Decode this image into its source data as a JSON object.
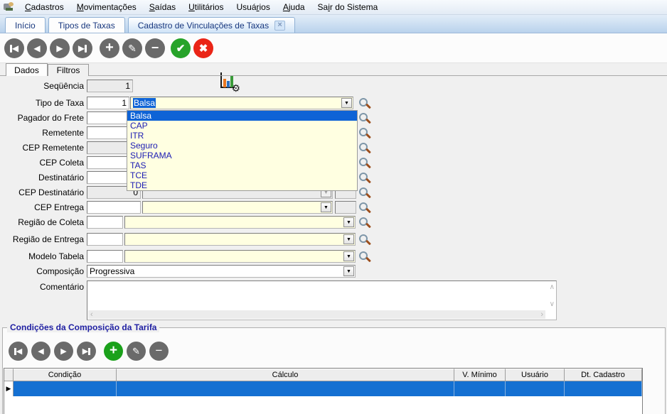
{
  "menubar": {
    "items": [
      {
        "label": "Cadastros",
        "underline": 0
      },
      {
        "label": "Movimentações",
        "underline": 0
      },
      {
        "label": "Saídas",
        "underline": 0
      },
      {
        "label": "Utilitários",
        "underline": 0
      },
      {
        "label": "Usuários",
        "underline": 4
      },
      {
        "label": "Ajuda",
        "underline": 0
      },
      {
        "label": "Sair do Sistema",
        "underline": 2
      }
    ]
  },
  "document_tabs": [
    {
      "label": "Início"
    },
    {
      "label": "Tipos de Taxas"
    },
    {
      "label": "Cadastro de Vinculações de Taxas"
    }
  ],
  "page_tabs": [
    {
      "label": "Dados"
    },
    {
      "label": "Filtros"
    }
  ],
  "form": {
    "fields": {
      "sequencia": {
        "label": "Seqüência",
        "value": "1"
      },
      "tipo_taxa": {
        "label": "Tipo de Taxa",
        "code": "1",
        "text": "Balsa"
      },
      "pagador_frete": {
        "label": "Pagador do Frete",
        "value": ""
      },
      "remetente": {
        "label": "Remetente",
        "value": ""
      },
      "cep_remetente": {
        "label": "CEP Remetente",
        "value": ""
      },
      "cep_coleta": {
        "label": "CEP Coleta",
        "value": ""
      },
      "destinatario": {
        "label": "Destinatário",
        "value": ""
      },
      "cep_destinatario": {
        "label": "CEP Destinatário",
        "value": "0"
      },
      "cep_entrega": {
        "label": "CEP Entrega",
        "value": ""
      },
      "regiao_coleta": {
        "label": "Região de Coleta",
        "value": ""
      },
      "regiao_entrega": {
        "label": "Região de Entrega",
        "value": ""
      },
      "modelo_tabela": {
        "label": "Modelo Tabela",
        "value": ""
      },
      "composicao": {
        "label": "Composição",
        "value": "Progressiva"
      },
      "comentario": {
        "label": "Comentário",
        "value": ""
      }
    }
  },
  "dropdown": {
    "selected_index": 0,
    "items": [
      "Balsa",
      "CAP",
      "ITR",
      "Seguro",
      "SUFRAMA",
      "TAS",
      "TCE",
      "TDE"
    ]
  },
  "group": {
    "title": "Condições da Composição da Tarifa",
    "grid": {
      "columns": [
        "Condição",
        "Cálculo",
        "V. Mínimo",
        "Usuário",
        "Dt. Cadastro"
      ],
      "rows": [
        {
          "condicao": "",
          "calculo": "",
          "v_minimo": "",
          "usuario": "",
          "dt_cadastro": ""
        }
      ]
    }
  },
  "icons": {
    "left_tri": "◀",
    "right_tri": "▶",
    "plus": "+",
    "minus": "−",
    "pencil": "✎",
    "check": "✔",
    "cancel": "✖",
    "gear": "⚙",
    "dropdown_arrow": "▼",
    "row_pointer": "▶",
    "close": "×",
    "scroll_up": "∧",
    "scroll_down": "∨",
    "scroll_left": "‹",
    "scroll_right": "›"
  },
  "colors": {
    "selection_blue": "#0e63d6",
    "grid_row_blue": "#1470d2",
    "field_cream": "#ffffe1",
    "readonly_gray": "#ebebeb",
    "tab_text_navy": "#17377e",
    "group_title_navy": "#2121a3",
    "list_text_blue": "#1b1bb3",
    "confirm_green": "#27a32a",
    "cancel_red": "#ea2517"
  }
}
